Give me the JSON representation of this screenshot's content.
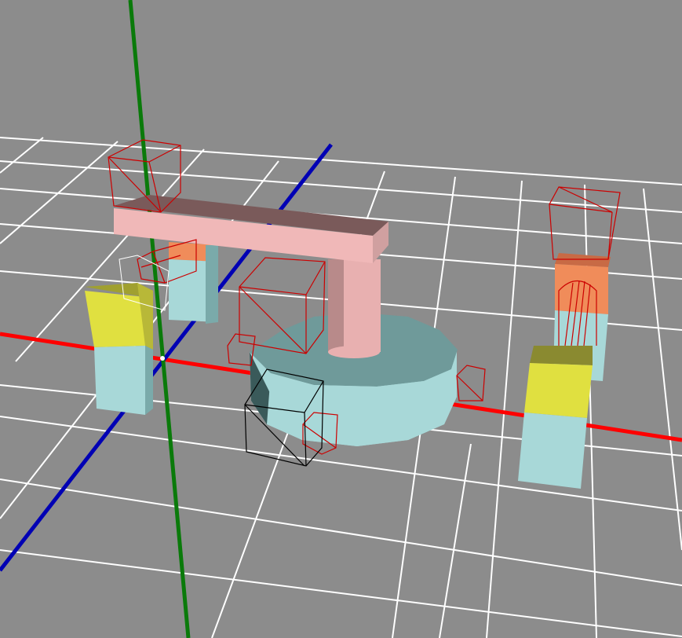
{
  "viewport": {
    "background": "#8c8c8c",
    "grid_color": "#ffffff",
    "axis_colors": {
      "x": "#ff0000",
      "y": "#0a7a0a",
      "z": "#0000b4"
    }
  },
  "scene": {
    "objects": [
      {
        "name": "base-cylinder",
        "color": "#a8d8d8",
        "shape": "cylinder"
      },
      {
        "name": "vertical-column",
        "color": "#e8b0b0",
        "shape": "cylinder"
      },
      {
        "name": "horizontal-arm",
        "color": "#f0b8b8",
        "shape": "box"
      },
      {
        "name": "left-front-pillar",
        "top_color": "#e0e040",
        "bottom_color": "#a8d8d8"
      },
      {
        "name": "left-back-pillar",
        "top_color": "#f08c5a",
        "bottom_color": "#a8d8d8"
      },
      {
        "name": "right-front-pillar",
        "top_color": "#e0e040",
        "bottom_color": "#a8d8d8"
      },
      {
        "name": "right-back-pillar",
        "top_color": "#f08c5a",
        "bottom_color": "#a8d8d8"
      }
    ],
    "bounding_box_color": "#cc0000",
    "selected_box_color": "#000000"
  }
}
